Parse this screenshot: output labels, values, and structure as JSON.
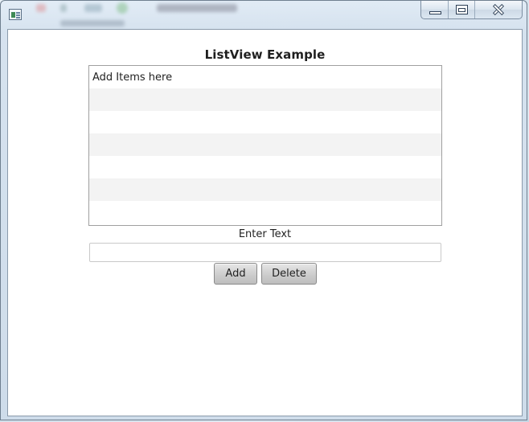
{
  "window": {
    "title_icon": "app-window-icon",
    "caption": {
      "minimize_icon": "minimize-icon",
      "maximize_icon": "restore-icon",
      "close_icon": "close-icon"
    }
  },
  "content": {
    "title": "ListView Example",
    "list": {
      "items": [
        "Add Items here",
        "",
        "",
        "",
        "",
        "",
        ""
      ]
    },
    "input_label": "Enter Text",
    "input_value": "",
    "input_placeholder": "",
    "add_label": "Add",
    "delete_label": "Delete"
  },
  "colors": {
    "list_stripe": "#f3f3f3",
    "list_border": "#a0a0a0",
    "button_gradient_top": "#e6e6e6",
    "button_gradient_bottom": "#bdbdbd"
  }
}
